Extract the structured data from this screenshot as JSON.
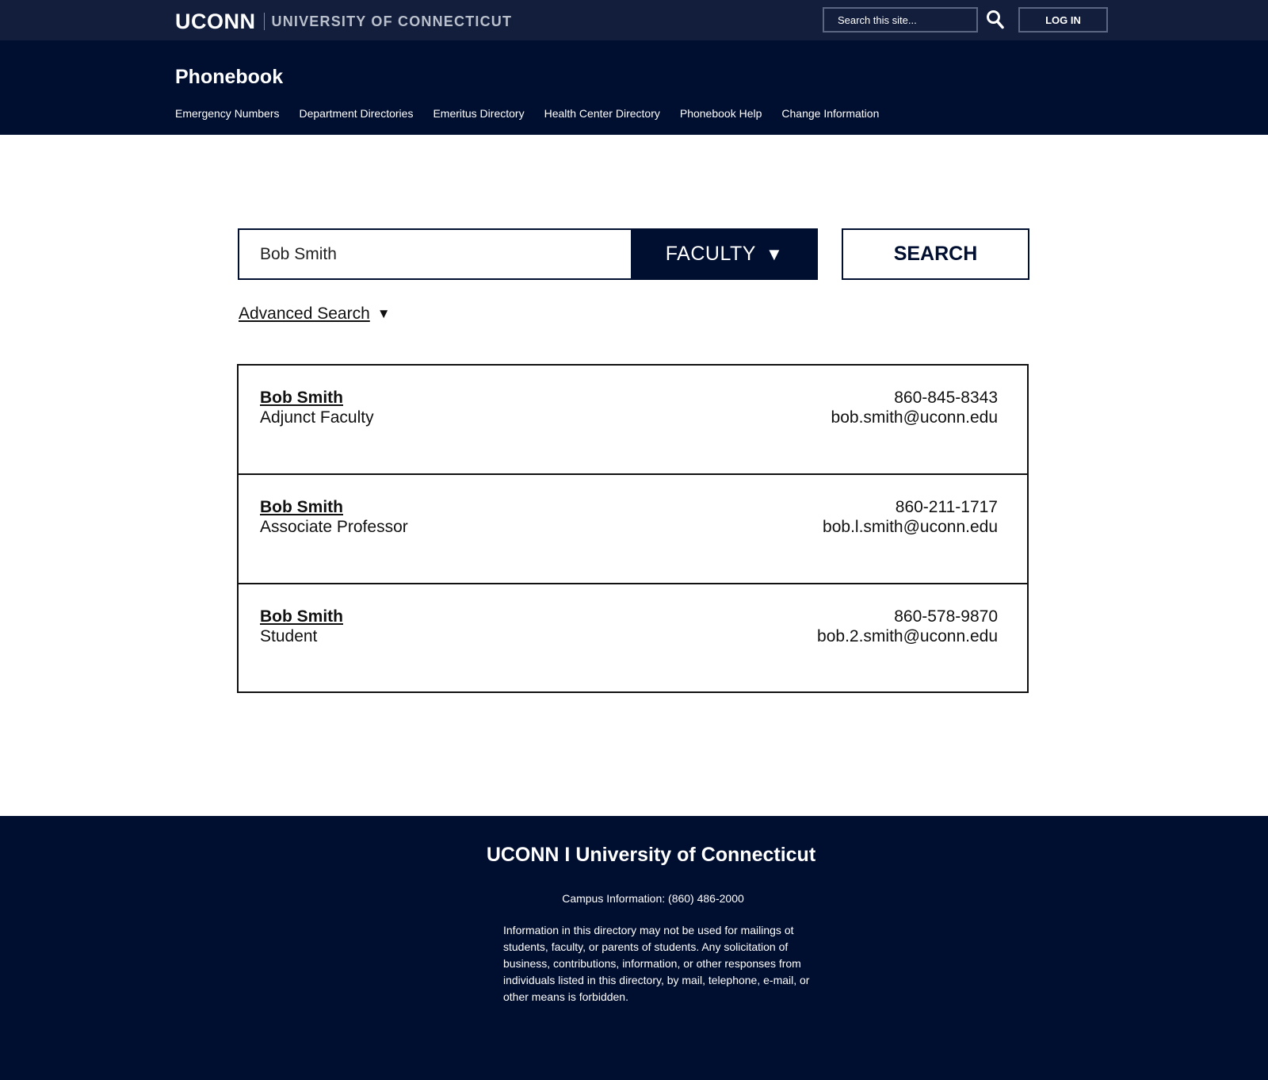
{
  "topbar": {
    "brand_uconn": "UCONN",
    "brand_university": "UNIVERSITY OF CONNECTICUT",
    "search_placeholder": "Search this site...",
    "login_label": "LOG IN"
  },
  "header": {
    "title": "Phonebook",
    "nav": [
      "Emergency Numbers",
      "Department Directories",
      "Emeritus Directory",
      "Health Center Directory",
      "Phonebook Help",
      "Change Information"
    ]
  },
  "search": {
    "query": "Bob Smith",
    "category": "FACULTY",
    "button_label": "SEARCH",
    "advanced_label": "Advanced Search"
  },
  "results": [
    {
      "name": "Bob Smith",
      "title": "Adjunct Faculty",
      "phone": "860-845-8343",
      "email": "bob.smith@uconn.edu"
    },
    {
      "name": "Bob Smith",
      "title": "Associate Professor",
      "phone": "860-211-1717",
      "email": "bob.l.smith@uconn.edu"
    },
    {
      "name": "Bob Smith",
      "title": "Student",
      "phone": "860-578-9870",
      "email": "bob.2.smith@uconn.edu"
    }
  ],
  "footer": {
    "title": "UCONN I University of Connecticut",
    "campus_info": "Campus Information: (860) 486-2000",
    "notice": "Information in this directory may not be used for mailings ot students, faculty, or parents of students. Any solicitation of business, contributions, information, or other responses from individuals listed in this directory, by mail, telephone, e-mail, or other means is forbidden."
  },
  "colors": {
    "navy": "#000e2f",
    "topbar": "#121e3c",
    "border_muted": "#5b6682"
  }
}
